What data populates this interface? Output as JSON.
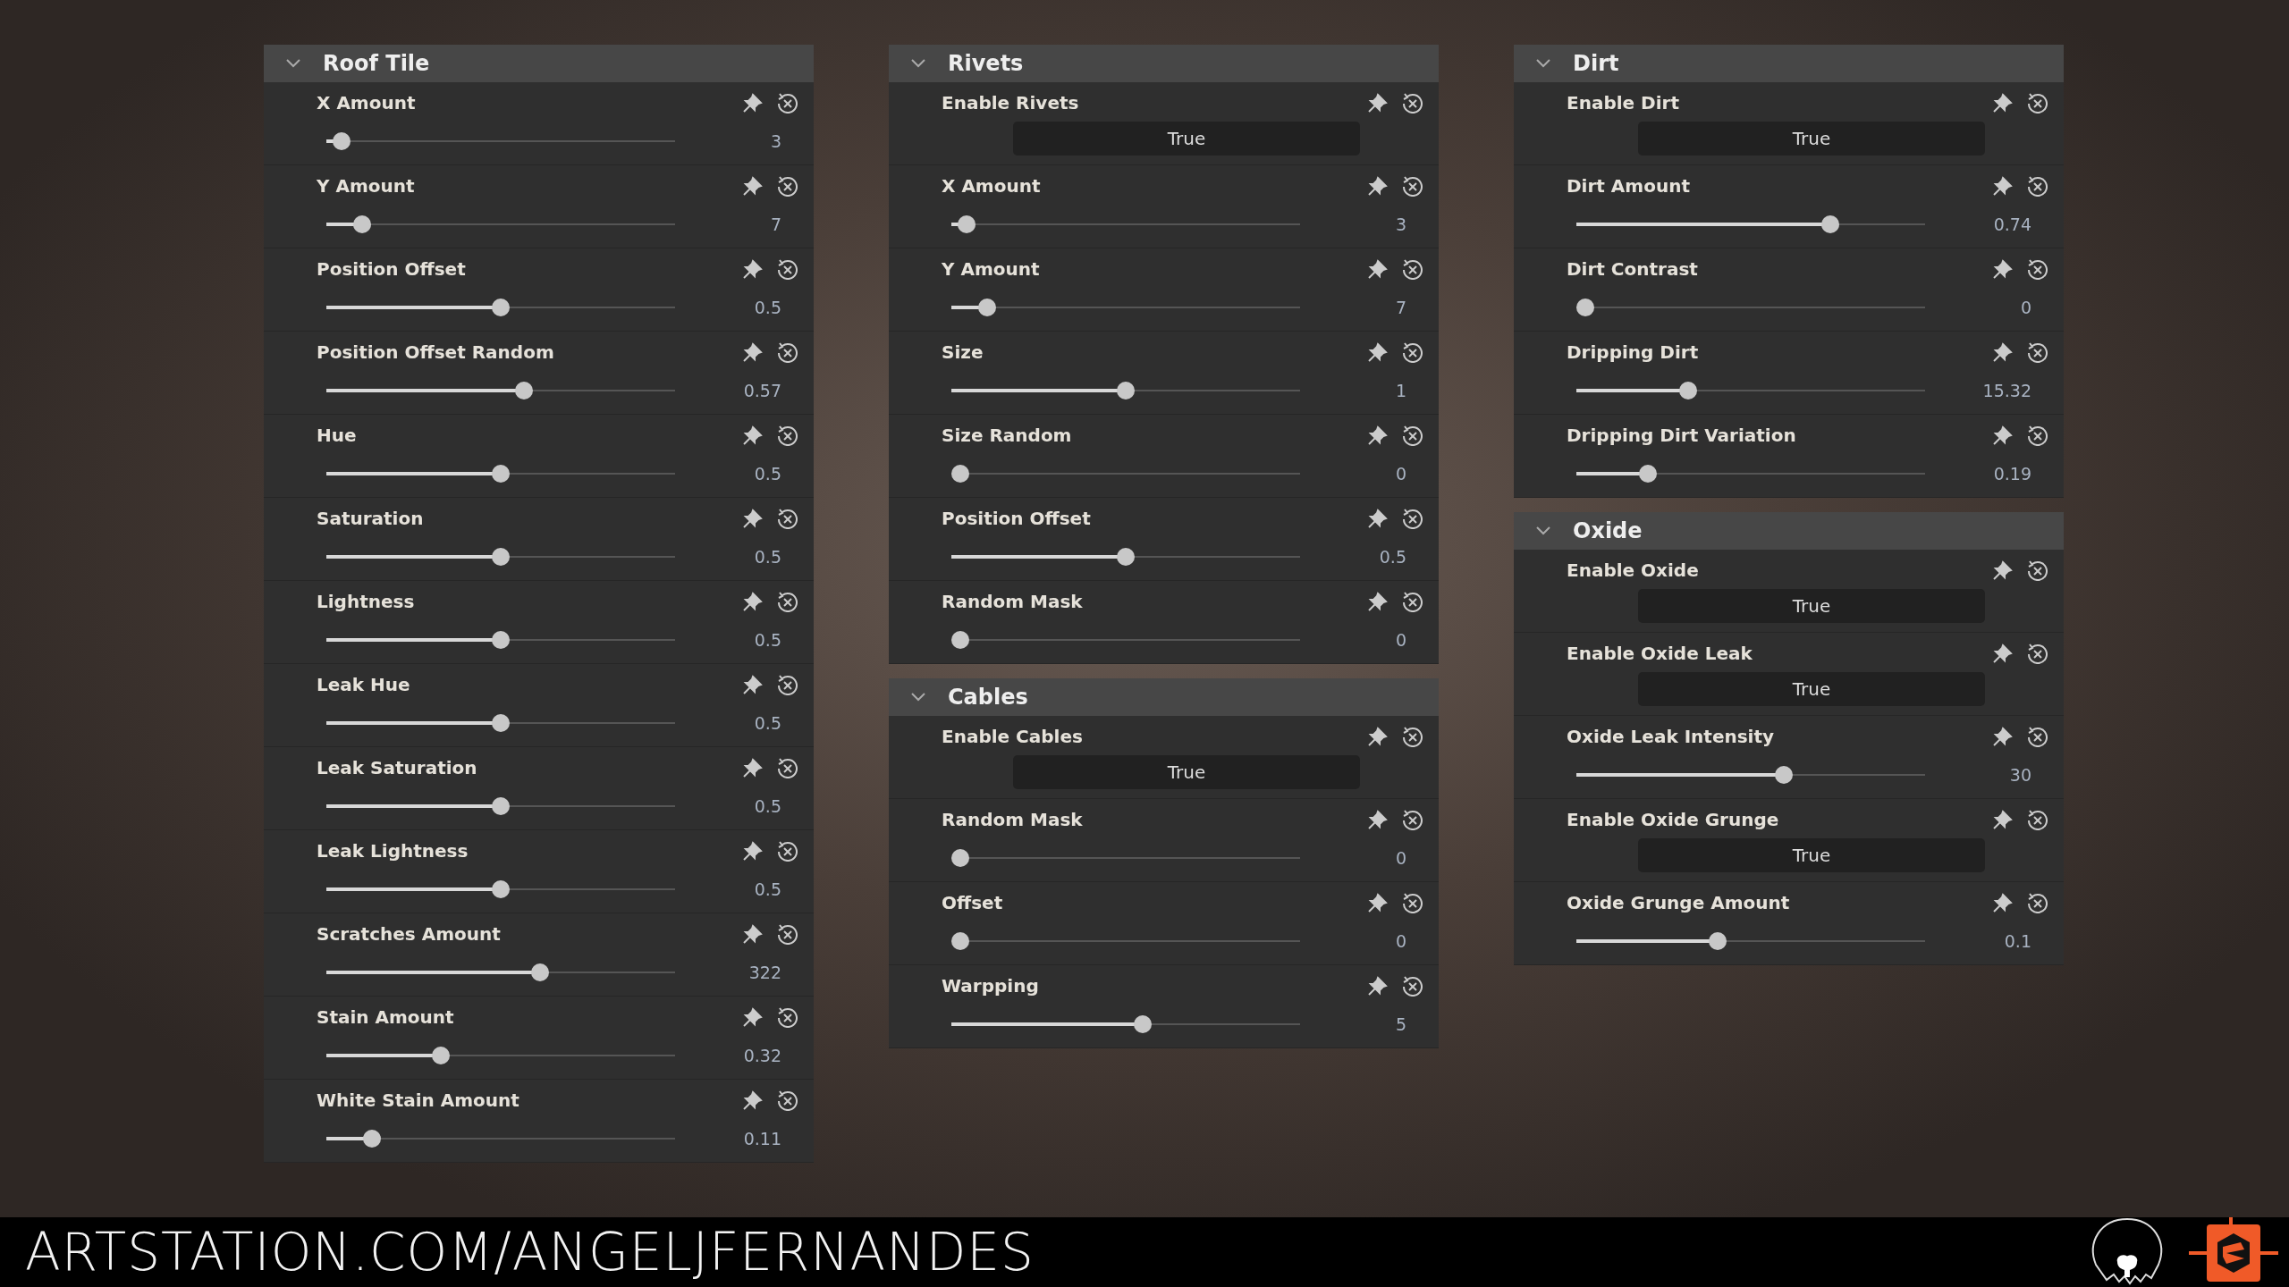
{
  "columns": [
    {
      "sections": [
        {
          "title": "Roof Tile",
          "expanded": true,
          "params": [
            {
              "kind": "slider",
              "label": "X Amount",
              "level": 0.02,
              "value": "3"
            },
            {
              "kind": "slider",
              "label": "Y Amount",
              "level": 0.08,
              "value": "7"
            },
            {
              "kind": "slider",
              "label": "Position Offset",
              "level": 0.5,
              "value": "0.5"
            },
            {
              "kind": "slider",
              "label": "Position Offset Random",
              "level": 0.57,
              "value": "0.57"
            },
            {
              "kind": "slider",
              "label": "Hue",
              "level": 0.5,
              "value": "0.5"
            },
            {
              "kind": "slider",
              "label": "Saturation",
              "level": 0.5,
              "value": "0.5"
            },
            {
              "kind": "slider",
              "label": "Lightness",
              "level": 0.5,
              "value": "0.5"
            },
            {
              "kind": "slider",
              "label": "Leak Hue",
              "level": 0.5,
              "value": "0.5"
            },
            {
              "kind": "slider",
              "label": "Leak Saturation",
              "level": 0.5,
              "value": "0.5"
            },
            {
              "kind": "slider",
              "label": "Leak Lightness",
              "level": 0.5,
              "value": "0.5"
            },
            {
              "kind": "slider",
              "label": "Scratches Amount",
              "level": 0.62,
              "value": "322"
            },
            {
              "kind": "slider",
              "label": "Stain Amount",
              "level": 0.32,
              "value": "0.32"
            },
            {
              "kind": "slider",
              "label": "White Stain Amount",
              "level": 0.11,
              "value": "0.11"
            }
          ]
        }
      ]
    },
    {
      "sections": [
        {
          "title": "Rivets",
          "expanded": true,
          "params": [
            {
              "kind": "toggle",
              "label": "Enable Rivets",
              "value": "True"
            },
            {
              "kind": "slider",
              "label": "X Amount",
              "level": 0.02,
              "value": "3"
            },
            {
              "kind": "slider",
              "label": "Y Amount",
              "level": 0.08,
              "value": "7"
            },
            {
              "kind": "slider",
              "label": "Size",
              "level": 0.5,
              "value": "1"
            },
            {
              "kind": "slider",
              "label": "Size Random",
              "level": 0,
              "value": "0"
            },
            {
              "kind": "slider",
              "label": "Position Offset",
              "level": 0.5,
              "value": "0.5"
            },
            {
              "kind": "slider",
              "label": "Random Mask",
              "level": 0,
              "value": "0"
            }
          ]
        },
        {
          "title": "Cables",
          "expanded": true,
          "params": [
            {
              "kind": "toggle",
              "label": "Enable Cables",
              "value": "True"
            },
            {
              "kind": "slider",
              "label": "Random Mask",
              "level": 0,
              "value": "0"
            },
            {
              "kind": "slider",
              "label": "Offset",
              "level": 0,
              "value": "0"
            },
            {
              "kind": "slider",
              "label": "Warpping",
              "level": 0.55,
              "value": "5"
            }
          ]
        }
      ]
    },
    {
      "sections": [
        {
          "title": "Dirt",
          "expanded": true,
          "params": [
            {
              "kind": "toggle",
              "label": "Enable Dirt",
              "value": "True"
            },
            {
              "kind": "slider",
              "label": "Dirt Amount",
              "level": 0.74,
              "value": "0.74"
            },
            {
              "kind": "slider",
              "label": "Dirt Contrast",
              "level": 0,
              "value": "0"
            },
            {
              "kind": "slider",
              "label": "Dripping Dirt",
              "level": 0.31,
              "value": "15.32"
            },
            {
              "kind": "slider",
              "label": "Dripping Dirt Variation",
              "level": 0.19,
              "value": "0.19"
            }
          ]
        },
        {
          "title": "Oxide",
          "expanded": true,
          "params": [
            {
              "kind": "toggle",
              "label": "Enable Oxide",
              "value": "True"
            },
            {
              "kind": "toggle",
              "label": "Enable Oxide Leak",
              "value": "True"
            },
            {
              "kind": "slider",
              "label": "Oxide Leak Intensity",
              "level": 0.6,
              "value": "30"
            },
            {
              "kind": "toggle",
              "label": "Enable Oxide Grunge",
              "value": "True"
            },
            {
              "kind": "slider",
              "label": "Oxide Grunge Amount",
              "level": 0.4,
              "value": "0.1"
            }
          ]
        }
      ]
    }
  ],
  "footer": {
    "text": "ARTSTATION.COM/ANGELJFERNANDES"
  }
}
